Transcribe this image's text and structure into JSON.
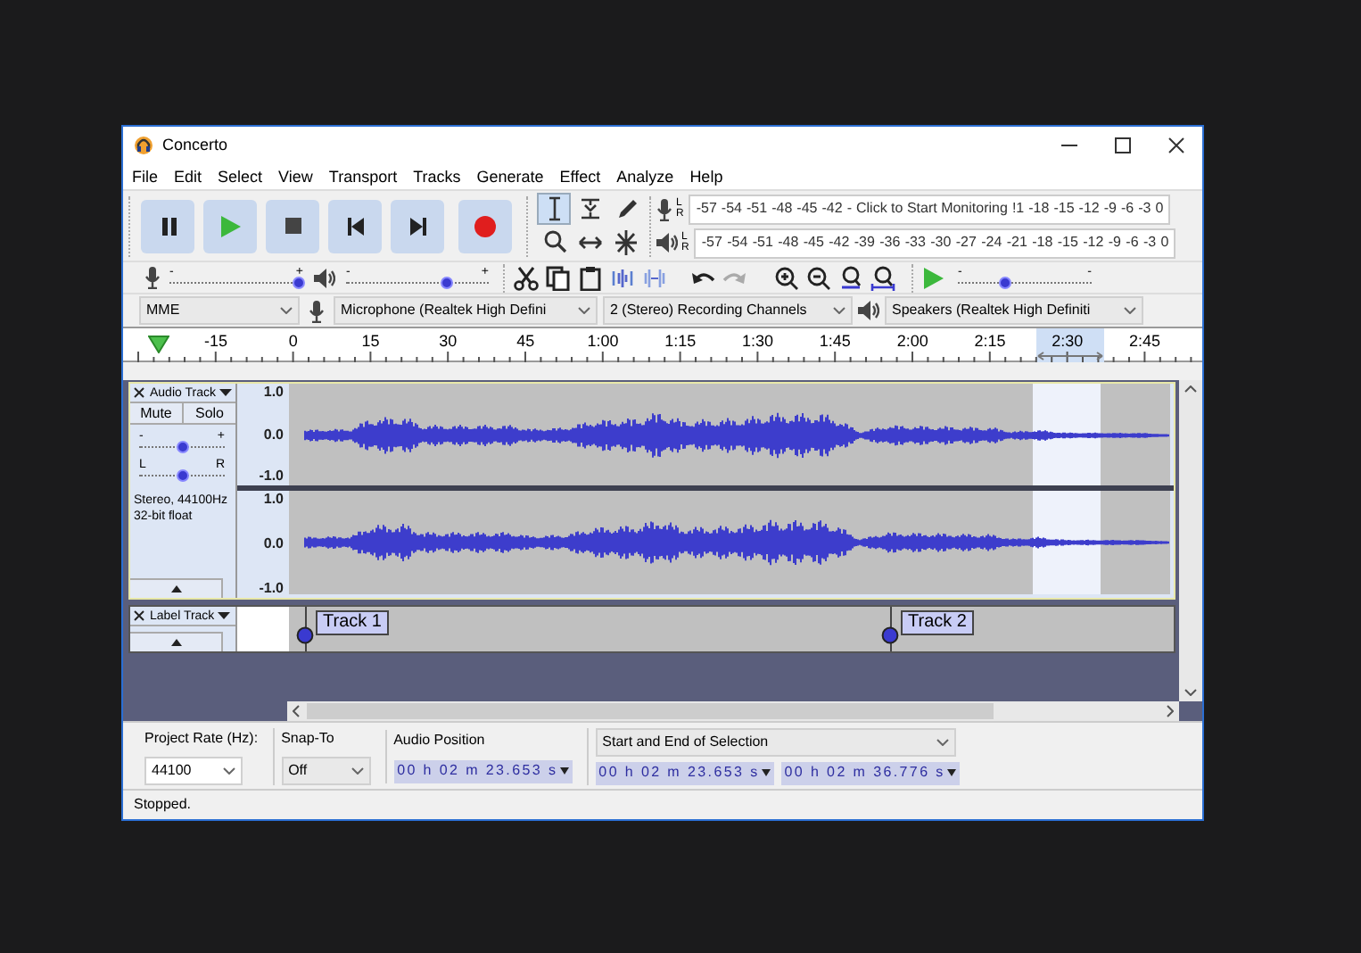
{
  "window": {
    "title": "Concerto"
  },
  "menu": [
    "File",
    "Edit",
    "Select",
    "View",
    "Transport",
    "Tracks",
    "Generate",
    "Effect",
    "Analyze",
    "Help"
  ],
  "tools": [
    {
      "kind": "select",
      "selected": true
    },
    {
      "kind": "envelope",
      "selected": false
    },
    {
      "kind": "draw",
      "selected": false
    },
    {
      "kind": "zoom",
      "selected": false
    },
    {
      "kind": "timeshift",
      "selected": false
    },
    {
      "kind": "multi",
      "selected": false
    }
  ],
  "recording_meter": {
    "channels": [
      "L",
      "R"
    ],
    "scale": [
      "-57",
      "-54",
      "-51",
      "-48",
      "-45",
      "-42",
      "-"
    ],
    "message": "Click to Start Monitoring",
    "scale_end": [
      "!1",
      "-18",
      "-15",
      "-12",
      "-9",
      "-6",
      "-3",
      "0"
    ]
  },
  "playback_meter": {
    "channels": [
      "L",
      "R"
    ],
    "scale": [
      "-57",
      "-54",
      "-51",
      "-48",
      "-45",
      "-42",
      "-39",
      "-36",
      "-33",
      "-30",
      "-27",
      "-24",
      "-21",
      "-18",
      "-15",
      "-12",
      "-9",
      "-6",
      "-3",
      "0"
    ]
  },
  "recording_volume": {
    "min_label": "-",
    "max_label": "+",
    "level": 0.97
  },
  "playback_volume": {
    "min_label": "-",
    "max_label": "+",
    "level": 0.7
  },
  "play_at_speed": {
    "min_label": "-",
    "max_label": "-",
    "level": 0.35
  },
  "devices": {
    "host": "MME",
    "microphone": "Microphone (Realtek High Defini",
    "channels": "2 (Stereo) Recording Channels",
    "speakers": "Speakers (Realtek High Definiti"
  },
  "ruler": {
    "ticks": [
      "-15",
      "0",
      "15",
      "30",
      "45",
      "1:00",
      "1:15",
      "1:30",
      "1:45",
      "2:00",
      "2:15",
      "2:30",
      "2:45"
    ]
  },
  "audio_track": {
    "name": "Audio Track",
    "mute": "Mute",
    "solo": "Solo",
    "gain": {
      "min_label": "-",
      "max_label": "+",
      "level": 0.5
    },
    "pan": {
      "min_label": "L",
      "max_label": "R",
      "level": 0.5
    },
    "info": [
      "Stereo, 44100Hz",
      "32-bit float"
    ],
    "channels": [
      {
        "scale": [
          "1.0",
          "0.0",
          "-1.0"
        ]
      },
      {
        "scale": [
          "1.0",
          "0.0",
          "-1.0"
        ]
      }
    ]
  },
  "label_track": {
    "name": "Label Track",
    "labels": [
      {
        "text": "Track 1"
      },
      {
        "text": "Track 2"
      }
    ]
  },
  "selection_toolbar": {
    "project_rate_label": "Project Rate (Hz):",
    "project_rate": "44100",
    "snap_label": "Snap-To",
    "snap": "Off",
    "audio_position_label": "Audio Position",
    "audio_position": "00 h 02 m 23.653 s",
    "selection_mode": "Start and End of Selection",
    "selection_start": "00 h 02 m 23.653 s",
    "selection_end": "00 h 02 m 36.776 s"
  },
  "status_bar": "Stopped."
}
